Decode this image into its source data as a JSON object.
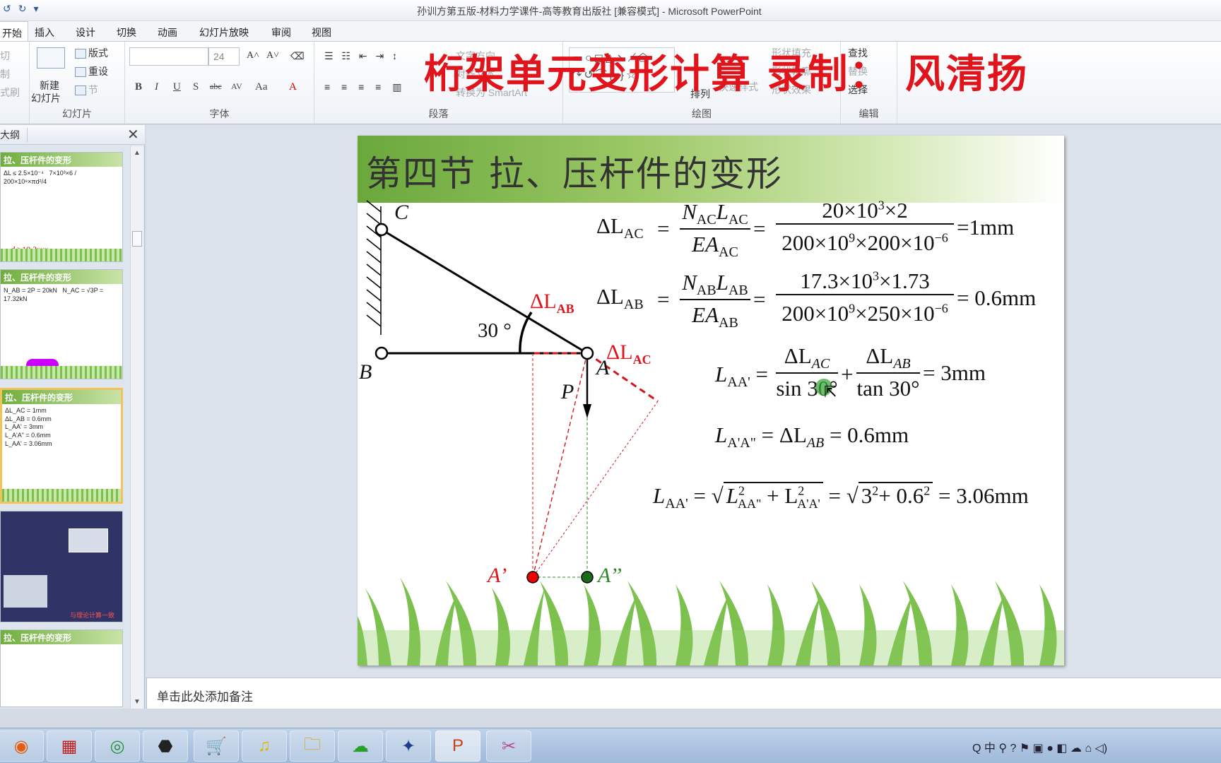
{
  "window": {
    "title": "孙训方第五版-材料力学课件-高等教育出版社 [兼容模式]  - Microsoft PowerPoint"
  },
  "tabs": [
    "开始",
    "插入",
    "设计",
    "切换",
    "动画",
    "幻灯片放映",
    "审阅",
    "视图"
  ],
  "ribbon": {
    "clipboard": {
      "items": [
        "切",
        "制",
        "式刷"
      ]
    },
    "slides": {
      "new_slide": "新建",
      "new_slide2": "幻灯片",
      "layout": "版式",
      "reset": "重设",
      "section": "节",
      "label": "幻灯片"
    },
    "font": {
      "size": "24",
      "label": "字体"
    },
    "paragraph": {
      "text_direction": "文字方向",
      "align": "对齐文本",
      "smartart": "转换为 SmartArt",
      "label": "段落"
    },
    "drawing": {
      "arrange": "排列",
      "quick_styles": "快速样式",
      "shape_fill": "形状填充",
      "shape_outline": "形状轮廓",
      "shape_effect": "形状效果",
      "label": "绘图"
    },
    "editing": {
      "find": "查找",
      "replace": "替换",
      "select": "选择",
      "label": "编辑"
    }
  },
  "overlay_caption": "桁架单元变形计算   录制：  风清扬",
  "thumbs": {
    "tab": "大纲",
    "slides": [
      {
        "title": "拉、压杆件的变形",
        "result": "d ≥10.3mm"
      },
      {
        "title": "拉、压杆件的变形",
        "result": ""
      },
      {
        "title": "拉、压杆件的变形",
        "result": ""
      },
      {
        "title": "",
        "result": "与理论计算一致"
      },
      {
        "title": "拉、压杆件的变形",
        "result": ""
      }
    ]
  },
  "slide": {
    "title": "第四节  拉、压杆件的变形",
    "labels": {
      "C": "C",
      "B": "B",
      "A": "A",
      "P": "P",
      "Ap": "A’",
      "App": "A’’",
      "angle": "30 °",
      "dLAB": "ΔL",
      "dLAB_sub": "AB",
      "dLAC": "ΔL",
      "dLAC_sub": "AC"
    },
    "eq1": {
      "lhs": "ΔL",
      "lhs_sub": "AC",
      "num": "N",
      "num_sub": "AC",
      "num2": "L",
      "num2_sub": "AC",
      "den": "EA",
      "den_sub": "AC",
      "num_v": "20×10",
      "num_v_sup": "3",
      "num_v2": "×2",
      "den_v": "200×10",
      "den_v_sup": "9",
      "den_v2": "×200×10",
      "den_v_sup2": "−6",
      "res": "=1mm"
    },
    "eq2": {
      "lhs": "ΔL",
      "lhs_sub": "AB",
      "num": "N",
      "num_sub": "AB",
      "num2": "L",
      "num2_sub": "AB",
      "den": "EA",
      "den_sub": "AB",
      "num_v": "17.3×10",
      "num_v_sup": "3",
      "num_v2": "×1.73",
      "den_v": "200×10",
      "den_v_sup": "9",
      "den_v2": "×250×10",
      "den_v_sup2": "−6",
      "res": "= 0.6mm"
    },
    "eq3": {
      "lhs": "L",
      "lhs_sub": "AA'",
      "num_a": "ΔL",
      "num_a_sub": "AC",
      "den_a": "sin 30°",
      "num_b": "ΔL",
      "num_b_sub": "AB",
      "den_b": "tan 30°",
      "res": "= 3mm"
    },
    "eq4": {
      "lhs": "L",
      "lhs_sub": "A'A\"",
      "rhs": "= ΔL",
      "rhs_sub": "AB",
      "res": "= 0.6mm"
    },
    "eq5": {
      "lhs": "L",
      "lhs_sub": "AA'",
      "t1": "L",
      "t1_sub": "AA\"",
      "t1_sup": "2",
      "t2": "+ L",
      "t2_sub": "A'A'",
      "t2_sup": "2",
      "mid": "3",
      "mid_sup": "2",
      "mid2": "+ 0.6",
      "mid2_sup": "2",
      "res": "= 3.06mm"
    }
  },
  "notes": {
    "placeholder": "单击此处添加备注"
  },
  "colors": {
    "accent_red": "#e0141a",
    "dashed_red": "#d4151b",
    "dashed_green": "#2c8a2c",
    "title_green": "#6aa83b"
  }
}
